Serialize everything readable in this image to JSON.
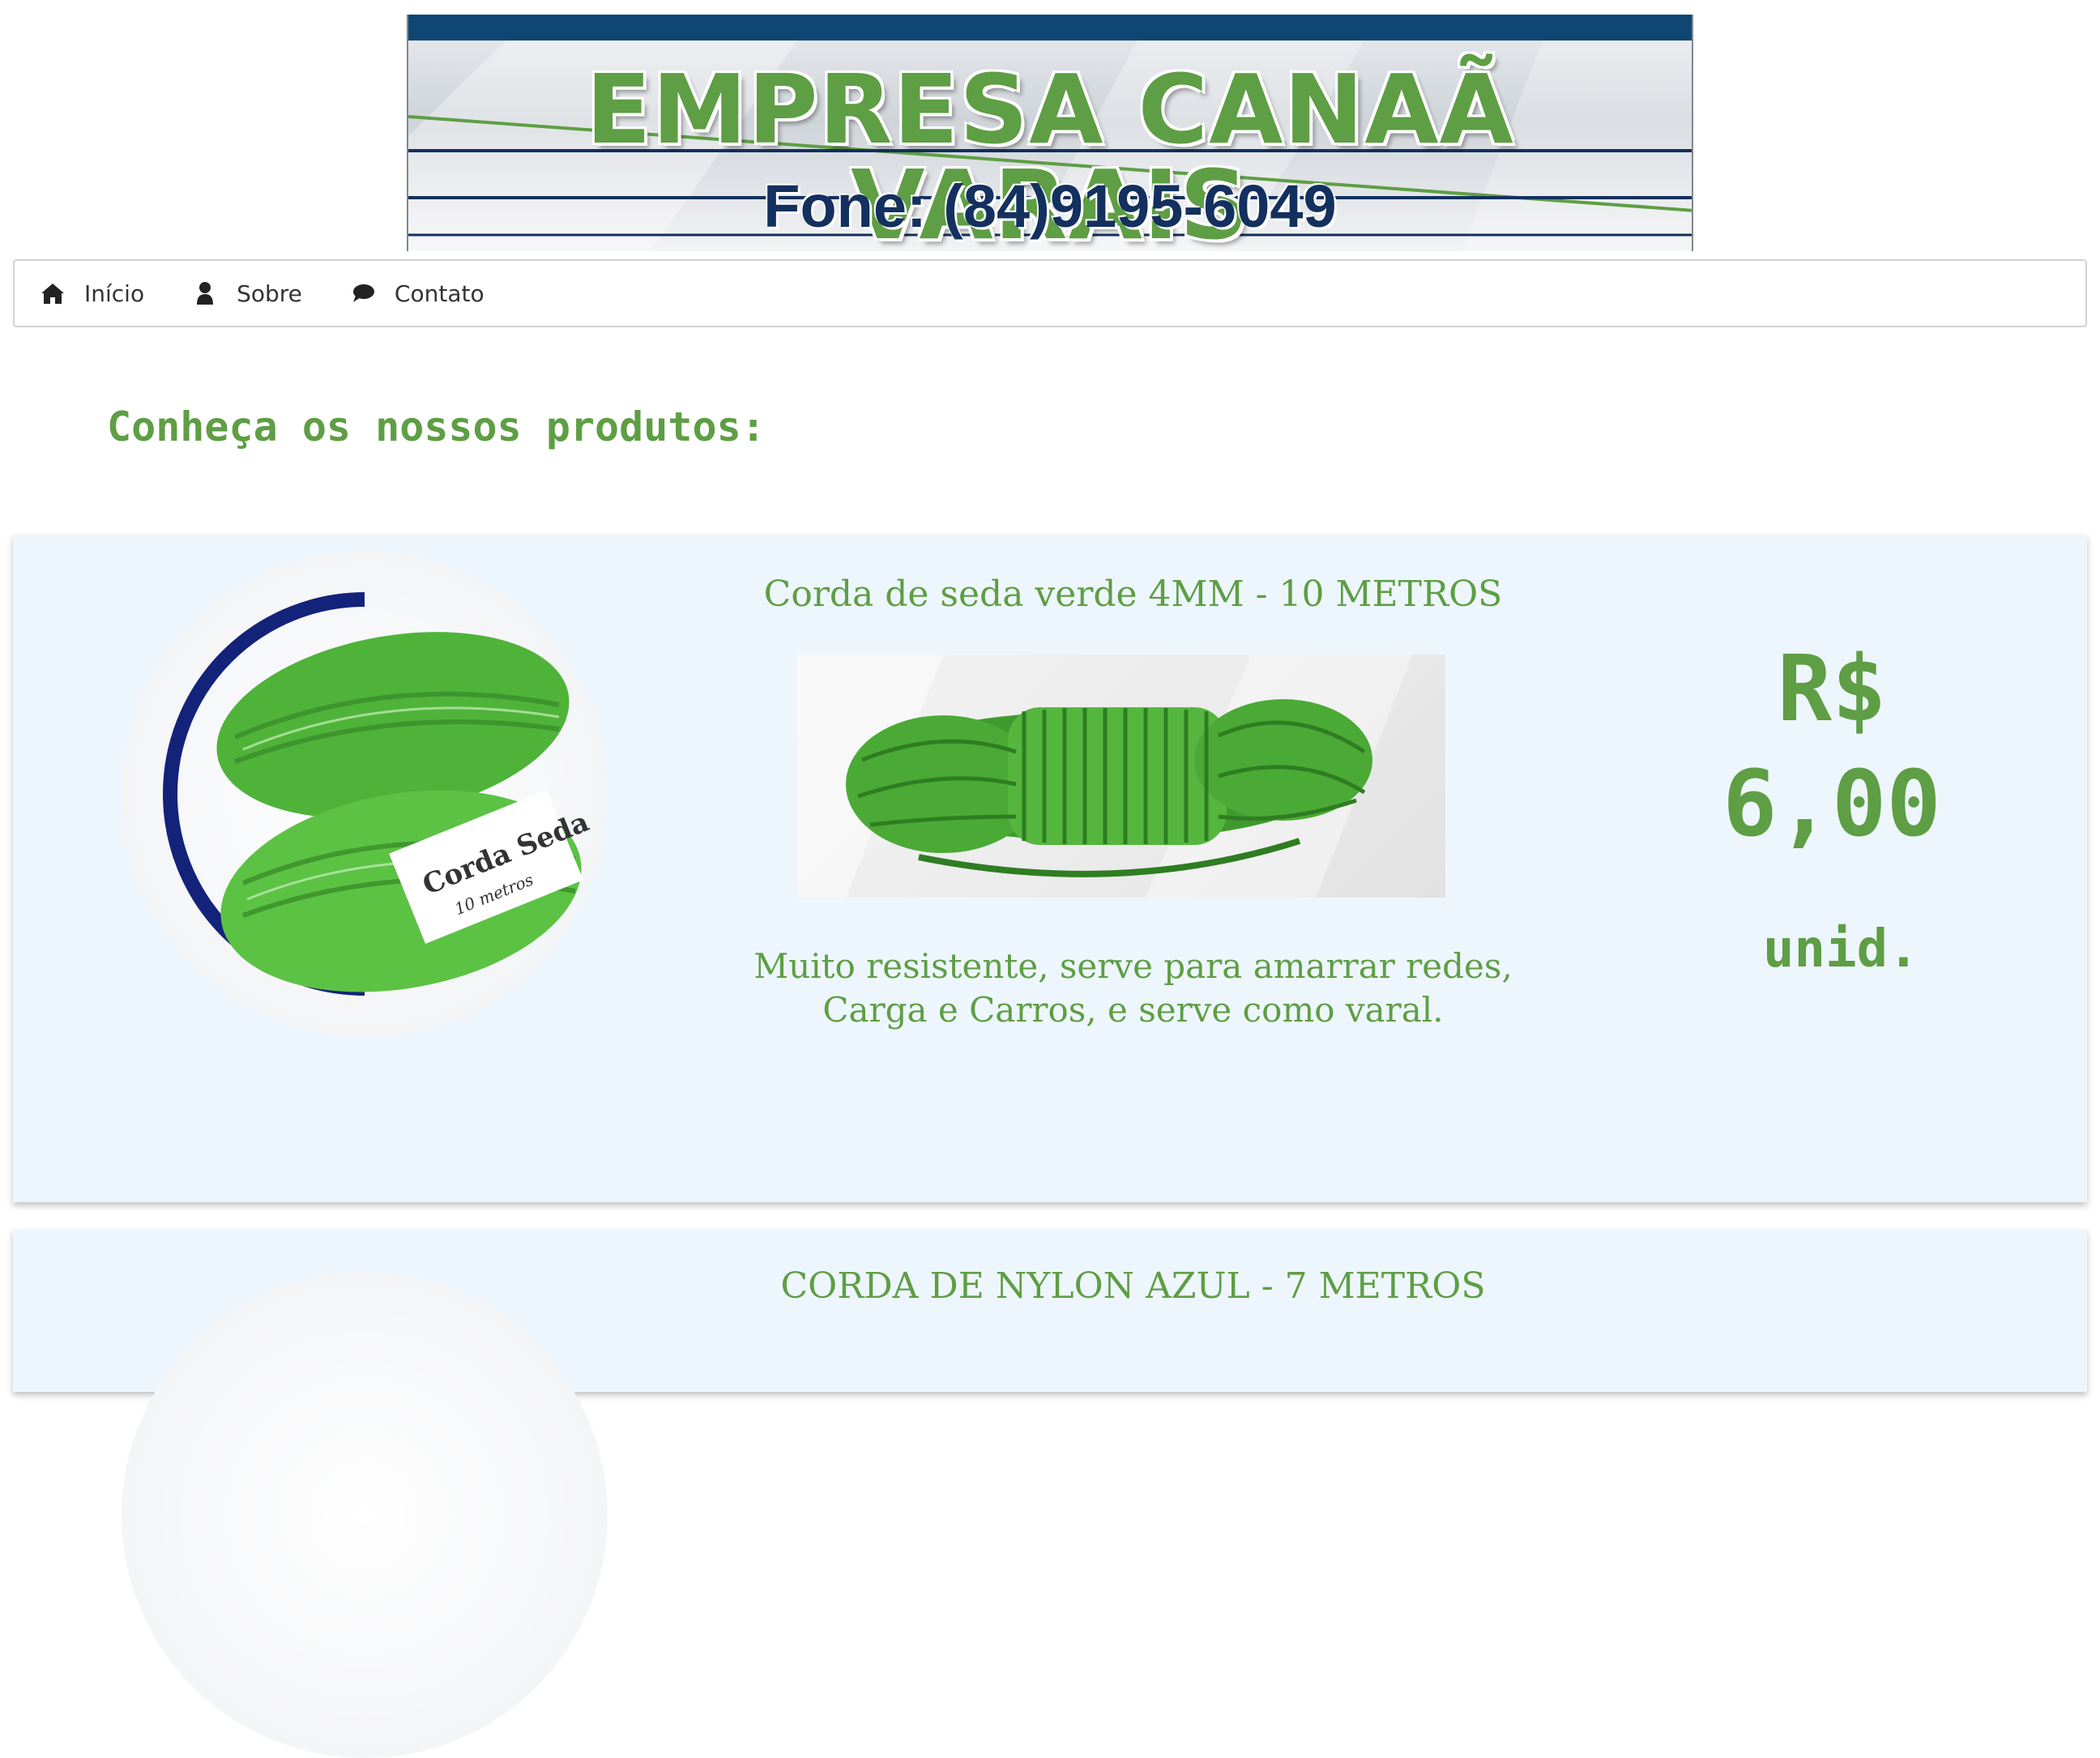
{
  "banner": {
    "company_name": "EMPRESA CANAÃ VARAIS",
    "phone": "Fone: (84)9195-6049"
  },
  "nav": {
    "items": [
      {
        "label": "Início",
        "icon": "home-icon"
      },
      {
        "label": "Sobre",
        "icon": "user-icon"
      },
      {
        "label": "Contato",
        "icon": "chat-bubble-icon"
      }
    ]
  },
  "section": {
    "heading": "Conheça os nossos produtos:"
  },
  "products": [
    {
      "title": "Corda de seda verde 4MM - 10 METROS",
      "description_line1": "Muito resistente, serve para amarrar redes,",
      "description_line2": "Carga e Carros, e serve como varal.",
      "price_currency": "R$",
      "price_value": "6,00",
      "unit": "unid.",
      "package_label": "Corda Seda",
      "package_sub": "10 metros"
    },
    {
      "title": "CORDA DE NYLON AZUL - 7 METROS"
    }
  ],
  "colors": {
    "accent_green": "#5e9e44",
    "banner_navy": "#0f4673",
    "card_bg": "#eef6fd"
  }
}
